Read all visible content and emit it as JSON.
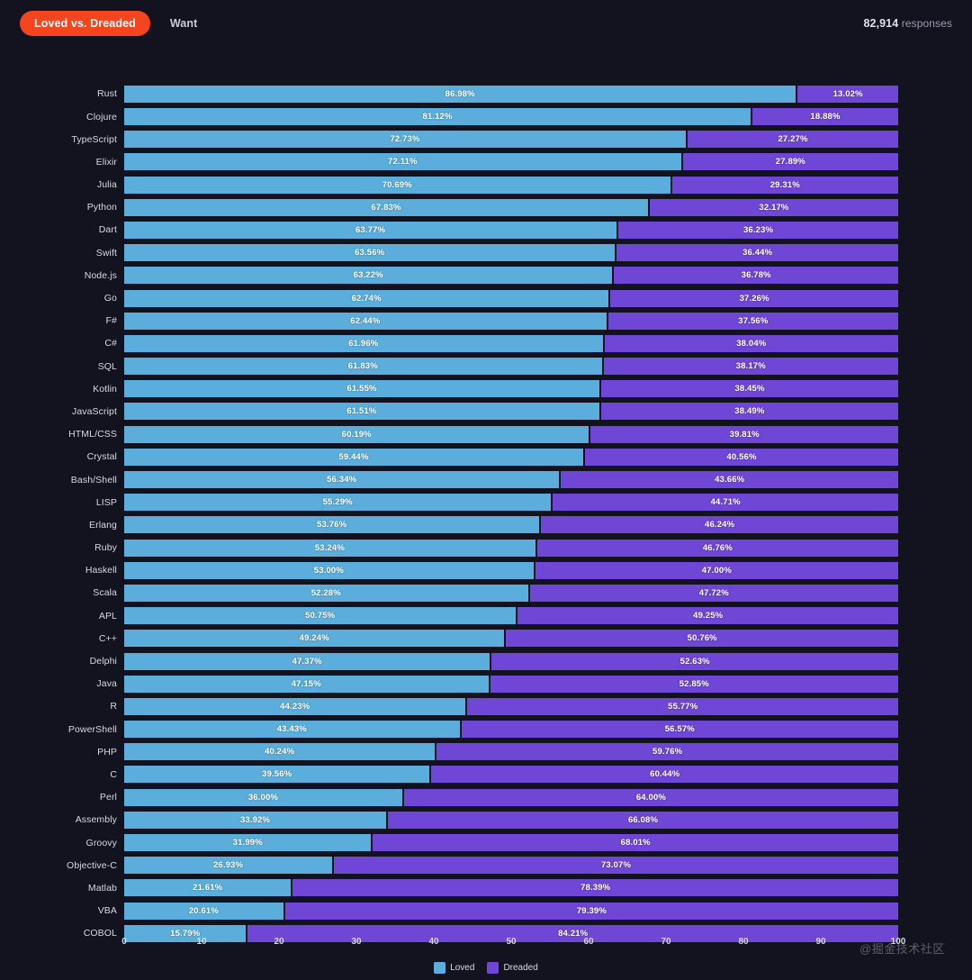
{
  "header": {
    "tabs": [
      {
        "label": "Loved vs. Dreaded",
        "active": true
      },
      {
        "label": "Want",
        "active": false
      }
    ],
    "responses_count": "82,914",
    "responses_label": " responses"
  },
  "colors": {
    "background": "#12131f",
    "loved": "#5BAEDB",
    "dreaded": "#6F46D6",
    "tab_active": "#f4451f",
    "text": "#d6d8e4"
  },
  "watermark": "@掘金技术社区",
  "chart_data": {
    "type": "bar",
    "orientation": "horizontal",
    "stacked": true,
    "title": "",
    "xlabel": "",
    "ylabel": "",
    "xlim": [
      0,
      100
    ],
    "xticks": [
      0,
      10,
      20,
      30,
      40,
      50,
      60,
      70,
      80,
      90,
      100
    ],
    "grid": false,
    "legend_position": "bottom",
    "legend": [
      "Loved",
      "Dreaded"
    ],
    "categories": [
      "Rust",
      "Clojure",
      "TypeScript",
      "Elixir",
      "Julia",
      "Python",
      "Dart",
      "Swift",
      "Node.js",
      "Go",
      "F#",
      "C#",
      "SQL",
      "Kotlin",
      "JavaScript",
      "HTML/CSS",
      "Crystal",
      "Bash/Shell",
      "LISP",
      "Erlang",
      "Ruby",
      "Haskell",
      "Scala",
      "APL",
      "C++",
      "Delphi",
      "Java",
      "R",
      "PowerShell",
      "PHP",
      "C",
      "Perl",
      "Assembly",
      "Groovy",
      "Objective-C",
      "Matlab",
      "VBA",
      "COBOL"
    ],
    "series": [
      {
        "name": "Loved",
        "color": "#5BAEDB",
        "values": [
          86.98,
          81.12,
          72.73,
          72.11,
          70.69,
          67.83,
          63.77,
          63.56,
          63.22,
          62.74,
          62.44,
          61.96,
          61.83,
          61.55,
          61.51,
          60.19,
          59.44,
          56.34,
          55.29,
          53.76,
          53.24,
          53.0,
          52.28,
          50.75,
          49.24,
          47.37,
          47.15,
          44.23,
          43.43,
          40.24,
          39.56,
          36.0,
          33.92,
          31.99,
          26.93,
          21.61,
          20.61,
          15.79
        ],
        "labels": [
          "86.98%",
          "81.12%",
          "72.73%",
          "72.11%",
          "70.69%",
          "67.83%",
          "63.77%",
          "63.56%",
          "63.22%",
          "62.74%",
          "62.44%",
          "61.96%",
          "61.83%",
          "61.55%",
          "61.51%",
          "60.19%",
          "59.44%",
          "56.34%",
          "55.29%",
          "53.76%",
          "53.24%",
          "53.00%",
          "52.28%",
          "50.75%",
          "49.24%",
          "47.37%",
          "47.15%",
          "44.23%",
          "43.43%",
          "40.24%",
          "39.56%",
          "36.00%",
          "33.92%",
          "31.99%",
          "26.93%",
          "21.61%",
          "20.61%",
          "15.79%"
        ]
      },
      {
        "name": "Dreaded",
        "color": "#6F46D6",
        "values": [
          13.02,
          18.88,
          27.27,
          27.89,
          29.31,
          32.17,
          36.23,
          36.44,
          36.78,
          37.26,
          37.56,
          38.04,
          38.17,
          38.45,
          38.49,
          39.81,
          40.56,
          43.66,
          44.71,
          46.24,
          46.76,
          47.0,
          47.72,
          49.25,
          50.76,
          52.63,
          52.85,
          55.77,
          56.57,
          59.76,
          60.44,
          64.0,
          66.08,
          68.01,
          73.07,
          78.39,
          79.39,
          84.21
        ],
        "labels": [
          "13.02%",
          "18.88%",
          "27.27%",
          "27.89%",
          "29.31%",
          "32.17%",
          "36.23%",
          "36.44%",
          "36.78%",
          "37.26%",
          "37.56%",
          "38.04%",
          "38.17%",
          "38.45%",
          "38.49%",
          "39.81%",
          "40.56%",
          "43.66%",
          "44.71%",
          "46.24%",
          "46.76%",
          "47.00%",
          "47.72%",
          "49.25%",
          "50.76%",
          "52.63%",
          "52.85%",
          "55.77%",
          "56.57%",
          "59.76%",
          "60.44%",
          "64.00%",
          "66.08%",
          "68.01%",
          "73.07%",
          "78.39%",
          "79.39%",
          "84.21%"
        ]
      }
    ]
  }
}
